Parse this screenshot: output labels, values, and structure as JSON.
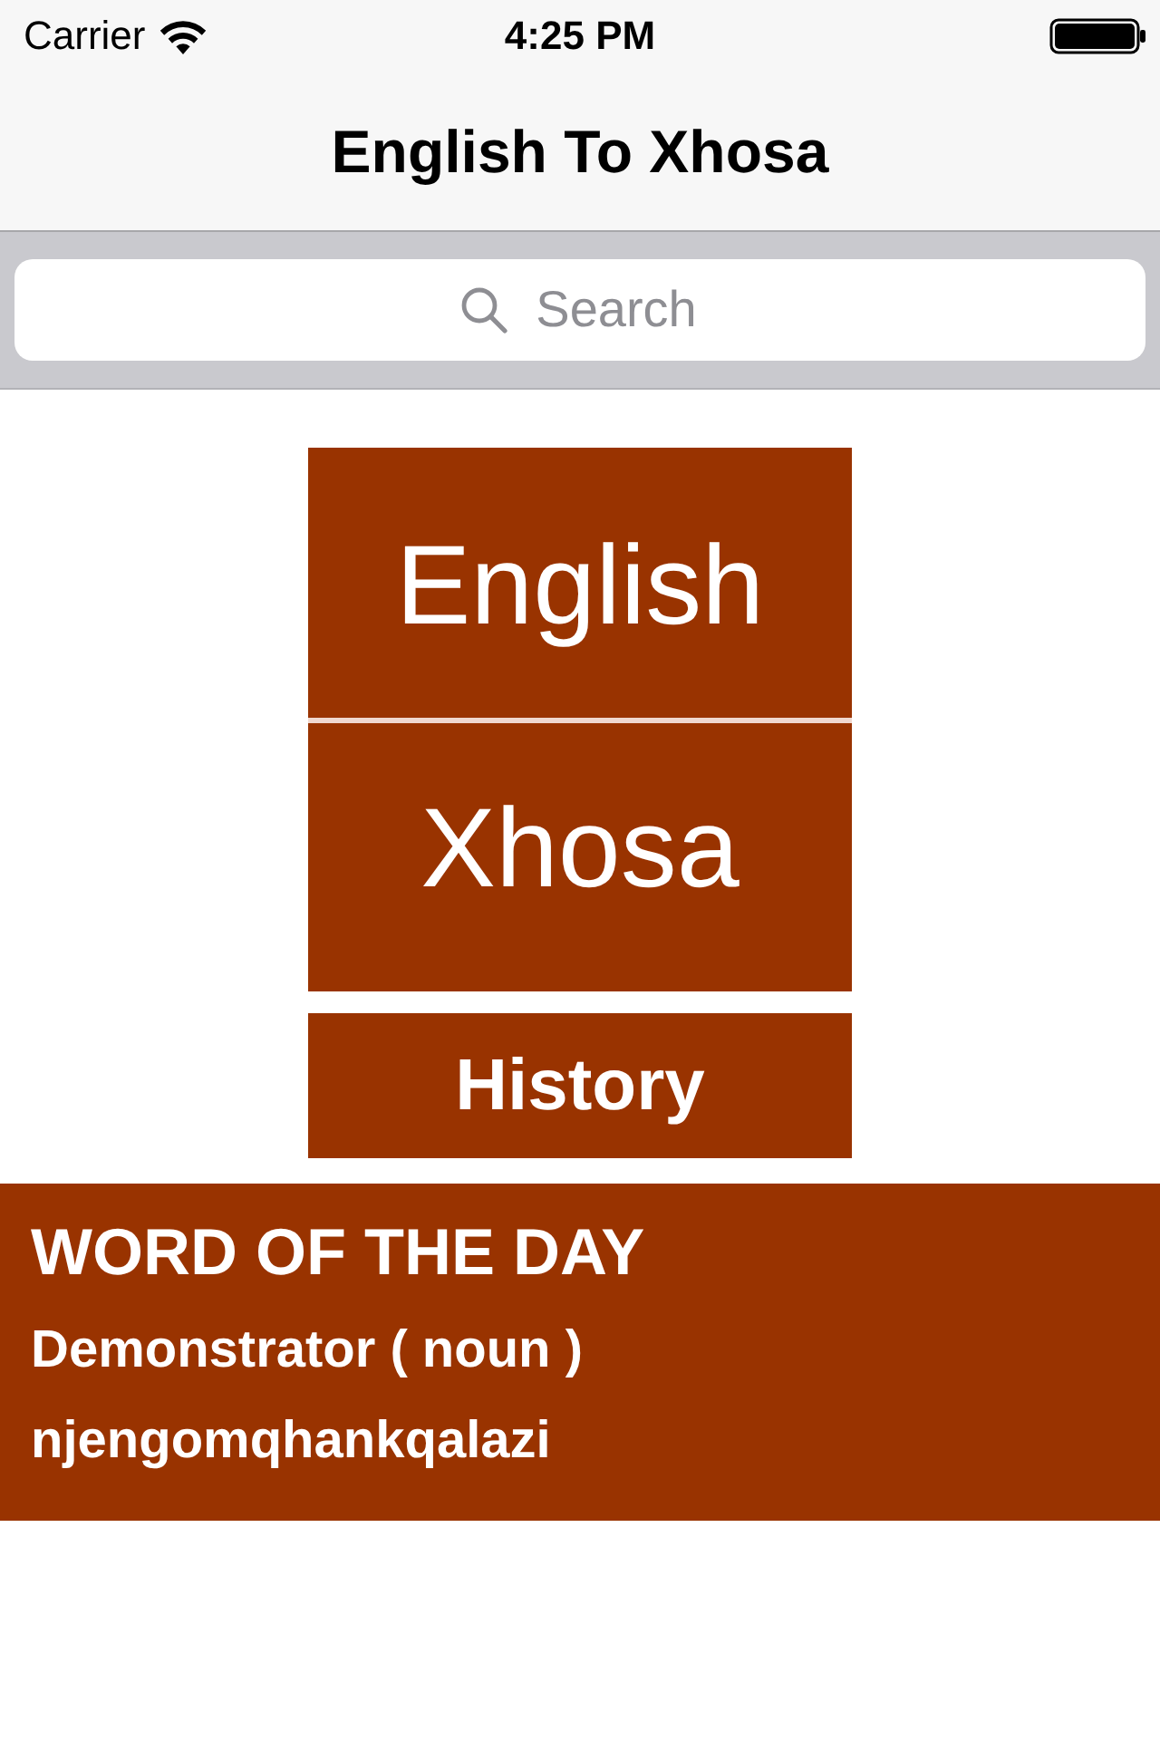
{
  "status_bar": {
    "carrier": "Carrier",
    "time": "4:25 PM"
  },
  "nav_bar": {
    "title": "English To Xhosa"
  },
  "search": {
    "placeholder": "Search"
  },
  "language_button": {
    "top_label": "English",
    "bottom_label": "Xhosa"
  },
  "history_button": {
    "label": "History"
  },
  "word_of_the_day": {
    "heading": "WORD OF THE DAY",
    "word": "Demonstrator ( noun )",
    "translation": "njengomqhankqalazi"
  }
}
